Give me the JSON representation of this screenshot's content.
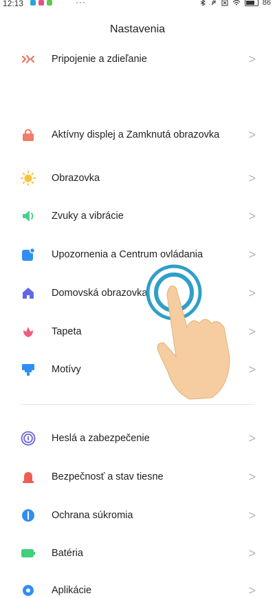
{
  "statusbar": {
    "time": "12:13",
    "dots": "···",
    "battery_percent": "86",
    "icons": [
      "bluetooth-icon",
      "mute-icon",
      "sim-off-icon",
      "wifi-icon",
      "battery-icon"
    ]
  },
  "header": {
    "title": "Nastavenia"
  },
  "items": [
    {
      "label": "Pripojenie a zdieľanie",
      "icon": "share-icon",
      "color": "#e8775f"
    },
    {
      "label": "Aktívny displej a Zamknutá obrazovka",
      "icon": "lock-icon",
      "color": "#ef7d6a"
    },
    {
      "label": "Obrazovka",
      "icon": "sun-icon",
      "color": "#f5c33b"
    },
    {
      "label": "Zvuky a vibrácie",
      "icon": "speaker-icon",
      "color": "#48d18a"
    },
    {
      "label": "Upozornenia a Centrum ovládania",
      "icon": "notification-icon",
      "color": "#2f8ff3"
    },
    {
      "label": "Domovská obrazovka",
      "icon": "home-icon",
      "color": "#6268e5"
    },
    {
      "label": "Tapeta",
      "icon": "flower-icon",
      "color": "#ef5e7a"
    },
    {
      "label": "Motívy",
      "icon": "brush-icon",
      "color": "#2f8ff3"
    },
    {
      "label": "Heslá a zabezpečenie",
      "icon": "fingerprint-icon",
      "color": "#6a62d8"
    },
    {
      "label": "Bezpečnosť a stav tiesne",
      "icon": "alarm-icon",
      "color": "#ef5e55"
    },
    {
      "label": "Ochrana súkromia",
      "icon": "privacy-icon",
      "color": "#2f8ff3"
    },
    {
      "label": "Batéria",
      "icon": "battery-icon",
      "color": "#3fd07a"
    },
    {
      "label": "Aplikácie",
      "icon": "gear-icon",
      "color": "#2f8ff3"
    }
  ],
  "chevron": ">"
}
